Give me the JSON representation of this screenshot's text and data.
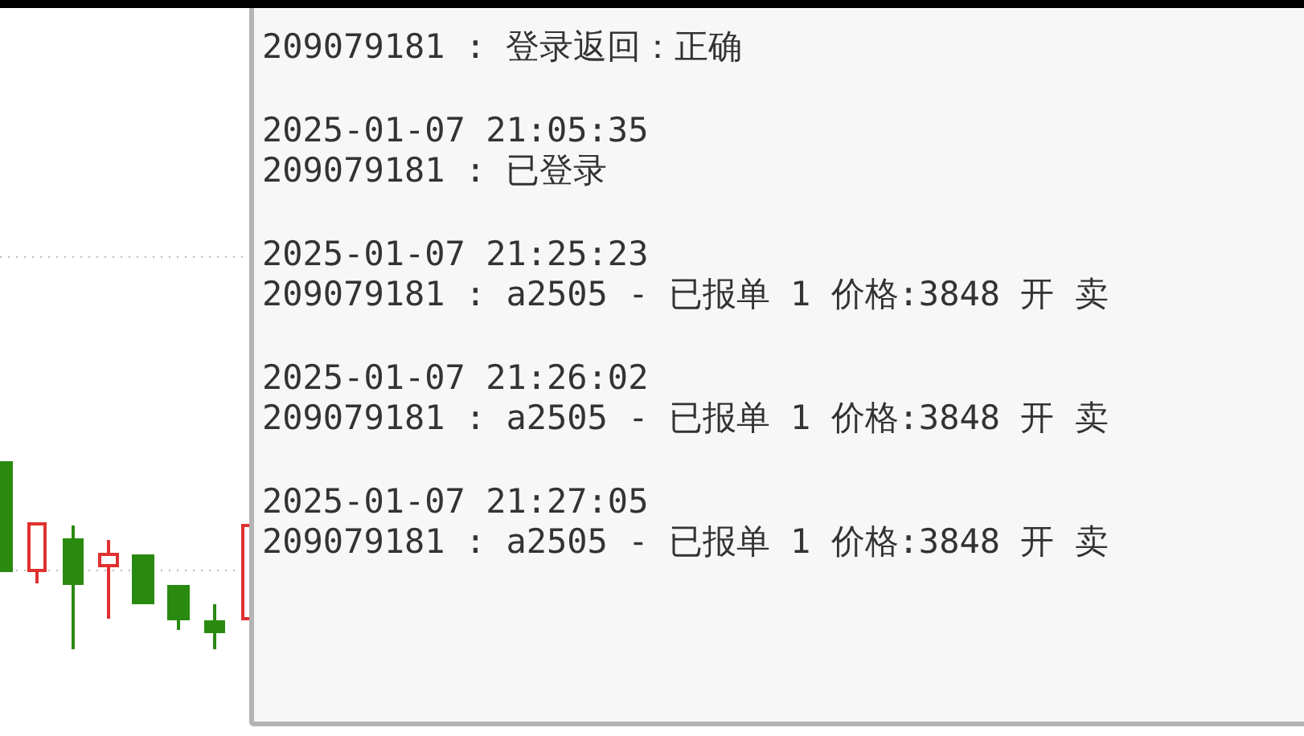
{
  "log_panel": {
    "entries": [
      {
        "message": "209079181 : 登录返回：正确"
      },
      {
        "time": "2025-01-07 21:05:35",
        "message": "209079181 : 已登录"
      },
      {
        "time": "2025-01-07 21:25:23",
        "message": "209079181 : a2505 - 已报单 1 价格:3848 开 卖"
      },
      {
        "time": "2025-01-07 21:26:02",
        "message": "209079181 : a2505 - 已报单 1 价格:3848 开 卖"
      },
      {
        "time": "2025-01-07 21:27:05",
        "message": "209079181 : a2505 - 已报单 1 价格:3848 开 卖"
      }
    ]
  }
}
